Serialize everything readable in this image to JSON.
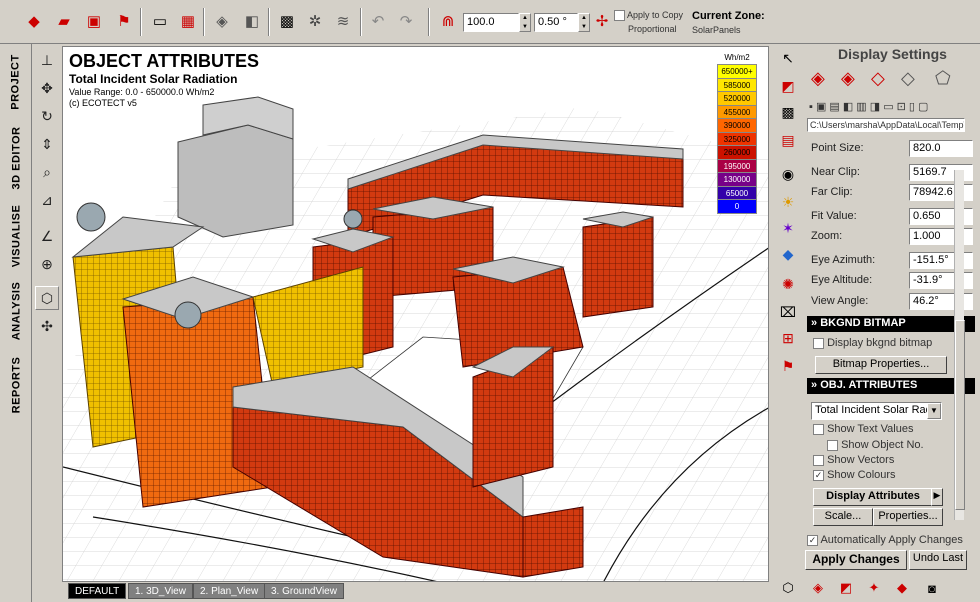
{
  "toolbar": {
    "zoom_value": "100.0",
    "step_value": "0.50 °",
    "apply_to_copy_label": "Apply to Copy",
    "proportional_label": "Proportional",
    "current_zone_label": "Current Zone:",
    "current_zone_value": "SolarPanels"
  },
  "left_tabs": [
    "PROJECT",
    "3D EDITOR",
    "VISUALISE",
    "ANALYSIS",
    "REPORTS"
  ],
  "viewport": {
    "title": "OBJECT ATTRIBUTES",
    "subtitle": "Total Incident Solar Radiation",
    "value_range": "Value Range: 0.0 - 650000.0 Wh/m2",
    "copyright": "(c) ECOTECT v5",
    "legend_unit": "Wh/m2",
    "legend": [
      {
        "label": "650000+",
        "color": "#ffff00"
      },
      {
        "label": "585000",
        "color": "#ffe600"
      },
      {
        "label": "520000",
        "color": "#ffc800"
      },
      {
        "label": "455000",
        "color": "#ff9900"
      },
      {
        "label": "390000",
        "color": "#ff6600"
      },
      {
        "label": "325000",
        "color": "#ee3300"
      },
      {
        "label": "260000",
        "color": "#cc1100"
      },
      {
        "label": "195000",
        "color": "#aa0044"
      },
      {
        "label": "130000",
        "color": "#770088"
      },
      {
        "label": "65000",
        "color": "#3300aa"
      },
      {
        "label": "0",
        "color": "#0000ff"
      }
    ]
  },
  "view_tabs": [
    "DEFAULT",
    "1. 3D_View",
    "2. Plan_View",
    "3. GroundView"
  ],
  "panel": {
    "title": "Display Settings",
    "path": "C:\\Users\\marsha\\AppData\\Local\\Temp\\E",
    "point_size_label": "Point Size:",
    "point_size_value": "820.0",
    "near_clip_label": "Near Clip:",
    "near_clip_value": "5169.7",
    "far_clip_label": "Far Clip:",
    "far_clip_value": "78942.6",
    "fit_value_label": "Fit Value:",
    "fit_value_value": "0.650",
    "zoom_label": "Zoom:",
    "zoom_value": "1.000",
    "eye_azimuth_label": "Eye Azimuth:",
    "eye_azimuth_value": "-151.5°",
    "eye_altitude_label": "Eye Altitude:",
    "eye_altitude_value": "-31.9°",
    "view_angle_label": "View Angle:",
    "view_angle_value": "46.2°",
    "bkgnd_header": "BKGND BITMAP",
    "display_bkgnd_label": "Display bkgnd bitmap",
    "bitmap_properties_label": "Bitmap Properties...",
    "obj_attr_header": "OBJ. ATTRIBUTES",
    "attribute_select": "Total Incident Solar Rad",
    "show_text_values": "Show Text Values",
    "show_object_no": "Show Object No.",
    "show_vectors": "Show Vectors",
    "show_colours": "Show Colours",
    "display_attributes_label": "Display Attributes",
    "scale_label": "Scale...",
    "properties_label": "Properties...",
    "auto_apply_label": "Automatically Apply Changes",
    "apply_changes_label": "Apply Changes",
    "undo_last_label": "Undo Last"
  }
}
